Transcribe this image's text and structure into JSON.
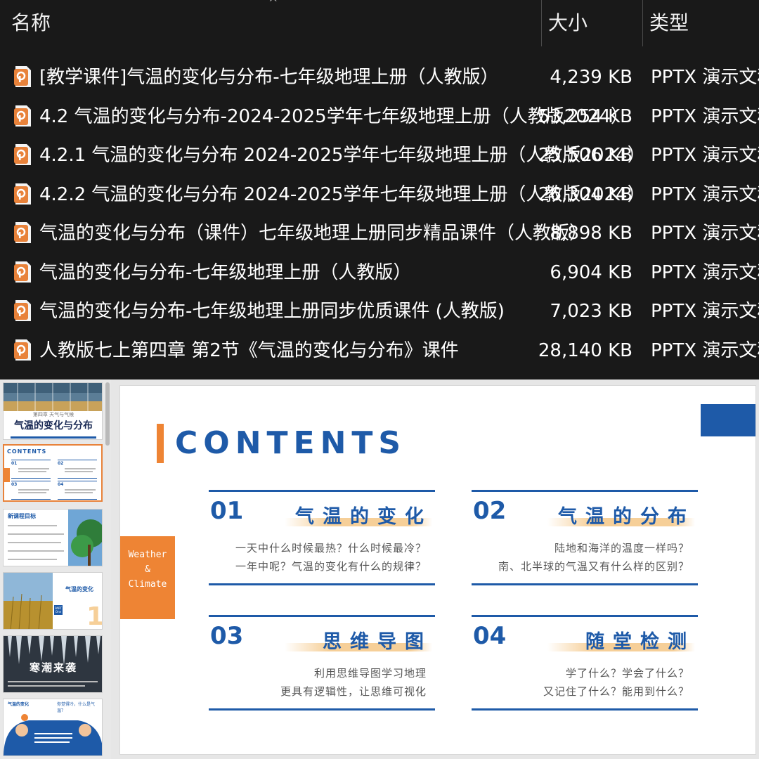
{
  "file_list": {
    "columns": {
      "name": "名称",
      "size": "大小",
      "type": "类型"
    },
    "sort_indicator": "^",
    "files": [
      {
        "name": "[教学课件]气温的变化与分布-七年级地理上册（人教版）",
        "size": "4,239 KB",
        "type": "PPTX 演示文稿"
      },
      {
        "name": "4.2 气温的变化与分布-2024-2025学年七年级地理上册（人教版2024）",
        "size": "53,254 KB",
        "type": "PPTX 演示文稿"
      },
      {
        "name": "4.2.1 气温的变化与分布 2024-2025学年七年级地理上册（人教版2024）",
        "size": "25,506 KB",
        "type": "PPTX 演示文稿"
      },
      {
        "name": "4.2.2 气温的变化与分布 2024-2025学年七年级地理上册（人教版2024）",
        "size": "26,304 KB",
        "type": "PPTX 演示文稿"
      },
      {
        "name": "气温的变化与分布（课件）七年级地理上册同步精品课件（人教版）",
        "size": "8,898 KB",
        "type": "PPTX 演示文稿"
      },
      {
        "name": "气温的变化与分布-七年级地理上册（人教版）",
        "size": "6,904 KB",
        "type": "PPTX 演示文稿"
      },
      {
        "name": "气温的变化与分布-七年级地理上册同步优质课件 (人教版)",
        "size": "7,023 KB",
        "type": "PPTX 演示文稿"
      },
      {
        "name": "人教版七上第四章 第2节《气温的变化与分布》课件",
        "size": "28,140 KB",
        "type": "PPTX 演示文稿"
      }
    ],
    "icon": "pptx-file-icon",
    "accent": "#e8823a"
  },
  "thumbnails": {
    "t1": {
      "title": "气温的变化与分布",
      "pre": "第四章 天气与气候"
    },
    "t2": {
      "title": "CONTENTS",
      "items": [
        "01",
        "02",
        "03",
        "04"
      ]
    },
    "t3": {
      "title": "新课程目标"
    },
    "t4": {
      "title": "气温的变化",
      "part": "PART One",
      "num": "1"
    },
    "t5": {
      "title": "寒潮来袭"
    },
    "t6": {
      "title": "气温的变化",
      "bubble": "你觉得冷，什么是气温？"
    }
  },
  "slide": {
    "title": "CONTENTS",
    "side_label": [
      "Weather",
      "&",
      "Climate"
    ],
    "colors": {
      "blue": "#1e5aa8",
      "orange": "#ee8434",
      "highlight": "#f6cf98"
    },
    "sections": [
      {
        "num": "01",
        "title": "气温的变化",
        "lines": [
          "一天中什么时候最热？什么时候最冷？",
          "一年中呢？气温的变化有什么的规律？"
        ]
      },
      {
        "num": "02",
        "title": "气温的分布",
        "lines": [
          "陆地和海洋的温度一样吗？",
          "南、北半球的气温又有什么样的区别？"
        ]
      },
      {
        "num": "03",
        "title": "思维导图",
        "lines": [
          "利用思维导图学习地理",
          "更具有逻辑性，让思维可视化"
        ]
      },
      {
        "num": "04",
        "title": "随堂检测",
        "lines": [
          "学了什么？学会了什么？",
          "又记住了什么？能用到什么？"
        ]
      }
    ]
  }
}
